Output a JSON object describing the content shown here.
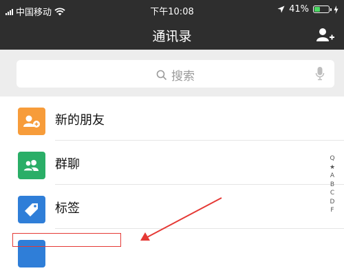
{
  "status_bar": {
    "carrier": "中国移动",
    "time": "下午10:08",
    "battery": "41%",
    "battery_level": 0.41
  },
  "nav": {
    "title": "通讯录",
    "add_icon": "add-contact-icon"
  },
  "search": {
    "placeholder": "搜索",
    "search_icon": "search-icon",
    "mic_icon": "microphone-icon"
  },
  "list": {
    "items": [
      {
        "label": "新的朋友",
        "icon": "new-friends-icon",
        "color": "#f79c3a"
      },
      {
        "label": "群聊",
        "icon": "group-chat-icon",
        "color": "#2aae67"
      },
      {
        "label": "标签",
        "icon": "tag-icon",
        "color": "#2f7ed8"
      },
      {
        "label": "",
        "icon": "official-accounts-icon",
        "color": "#2f7ed8"
      }
    ]
  },
  "index_bar": [
    "Q",
    "★",
    "A",
    "B",
    "C",
    "D",
    "F"
  ],
  "annotation": {
    "color": "#e53935"
  }
}
